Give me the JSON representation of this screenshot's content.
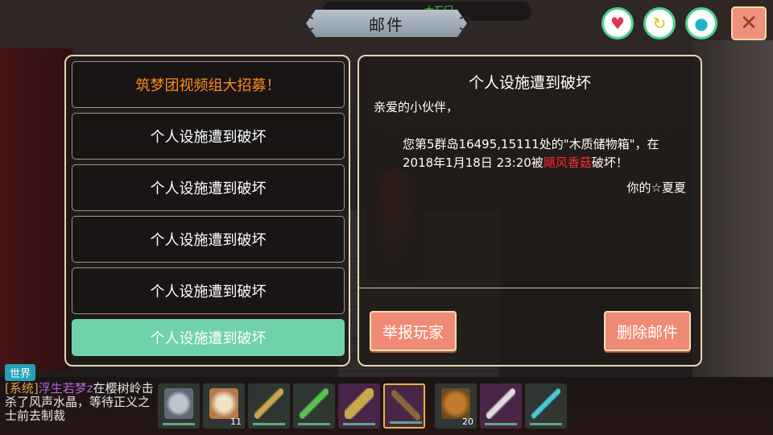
{
  "header": {
    "title": "邮件",
    "location": "大石门"
  },
  "top_buttons": {
    "heart_icon": "heart-icon",
    "refresh_icon": "refresh-icon",
    "drop_icon": "water-drop-icon",
    "close_symbol": "✕"
  },
  "mail_list": [
    {
      "subject": "筑梦团视频组大招募！"
    },
    {
      "subject": "个人设施遭到破坏"
    },
    {
      "subject": "个人设施遭到破坏"
    },
    {
      "subject": "个人设施遭到破坏"
    },
    {
      "subject": "个人设施遭到破坏"
    },
    {
      "subject": "个人设施遭到破坏"
    }
  ],
  "mail_detail": {
    "title": "个人设施遭到破坏",
    "greeting": "亲爱的小伙伴，",
    "body_part1": "您第5群岛16495,15111处的\"木质储物箱\"，在2018年1月18日 23:20被",
    "attacker": "飓风香菇",
    "body_part2": "破坏！",
    "signature": "你的☆夏夏",
    "report_button": "举报玩家",
    "delete_button": "删除邮件"
  },
  "chat": {
    "channel": "世界",
    "system_tag": "[系统]",
    "user": "浮生若梦z",
    "message": "在樱树岭击杀了风声水晶，等待正义之士前去制裁"
  },
  "hotbar": [
    {
      "icon": "stone-disc-icon",
      "count": ""
    },
    {
      "icon": "dumpling-steamer-icon",
      "count": "11"
    },
    {
      "icon": "bow-icon",
      "count": ""
    },
    {
      "icon": "green-bow-icon",
      "count": ""
    },
    {
      "icon": "battle-axe-icon",
      "count": ""
    },
    {
      "icon": "pickaxe-icon",
      "count": ""
    },
    {
      "icon": "seed-bag-icon",
      "count": "20"
    },
    {
      "icon": "sickle-icon",
      "count": ""
    },
    {
      "icon": "crystal-staff-icon",
      "count": ""
    }
  ]
}
